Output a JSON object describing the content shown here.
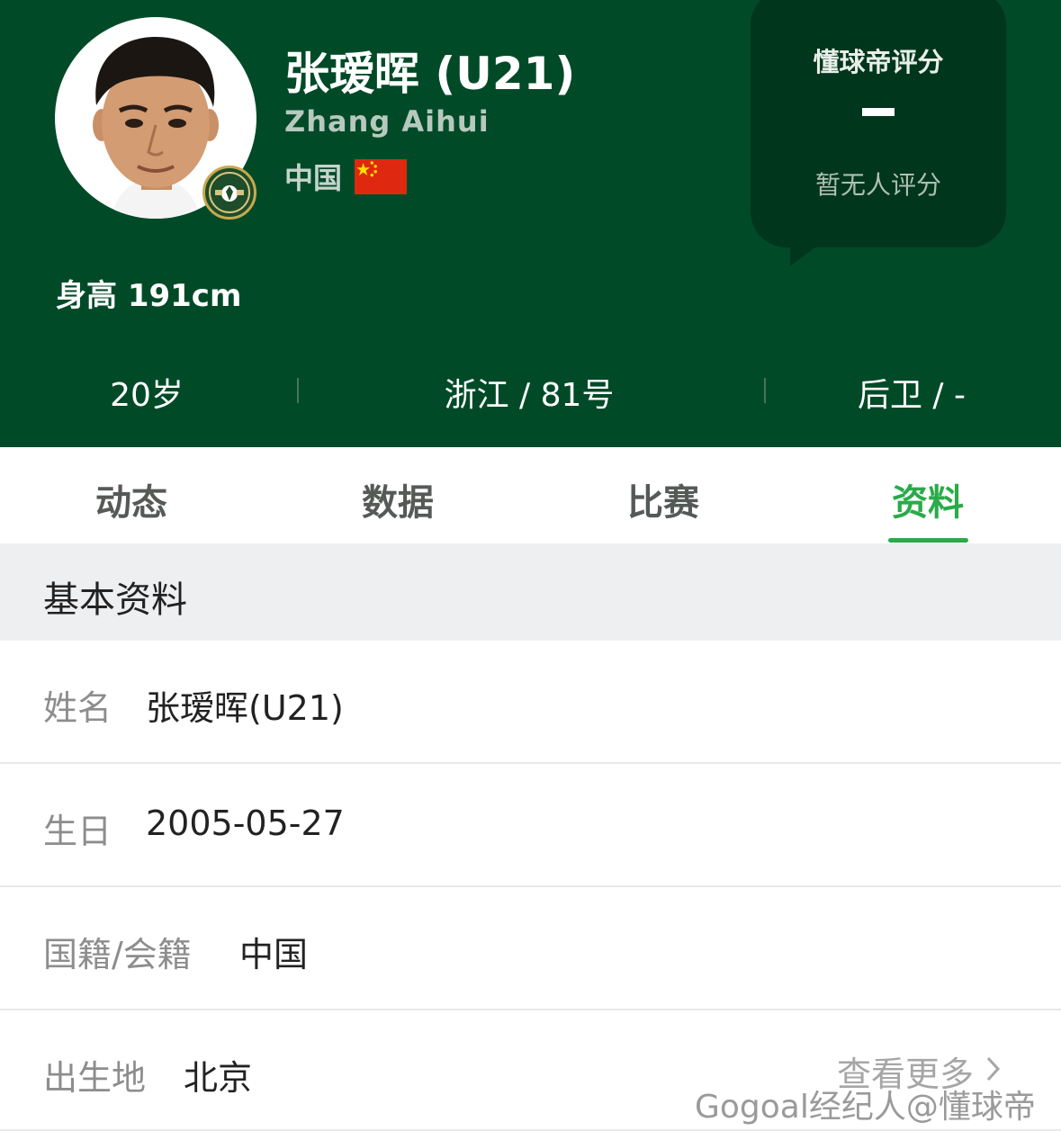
{
  "header": {
    "player_name": "张瑷晖 (U21)",
    "player_name_en": "Zhang Aihui",
    "country": "中国",
    "flag": "china-flag",
    "height_text": "身高 191cm",
    "background_color": "#004a28",
    "rating": {
      "title": "懂球帝评分",
      "value": "-",
      "subtitle": "暂无人评分"
    },
    "stats": {
      "age": "20岁",
      "team_number": "浙江 / 81号",
      "position": "后卫 / -"
    }
  },
  "tabs": [
    {
      "label": "动态",
      "active": false
    },
    {
      "label": "数据",
      "active": false
    },
    {
      "label": "比赛",
      "active": false
    },
    {
      "label": "资料",
      "active": true
    }
  ],
  "accent_color": "#29ab49",
  "section": {
    "title": "基本资料",
    "rows": [
      {
        "label": "姓名",
        "value": "张瑷晖(U21)"
      },
      {
        "label": "生日",
        "value": "2005-05-27"
      },
      {
        "label": "国籍/会籍",
        "value": "中国"
      },
      {
        "label": "出生地",
        "value": "北京"
      }
    ],
    "more_link": "查看更多"
  },
  "watermark": "Gogoal经纪人@懂球帝"
}
